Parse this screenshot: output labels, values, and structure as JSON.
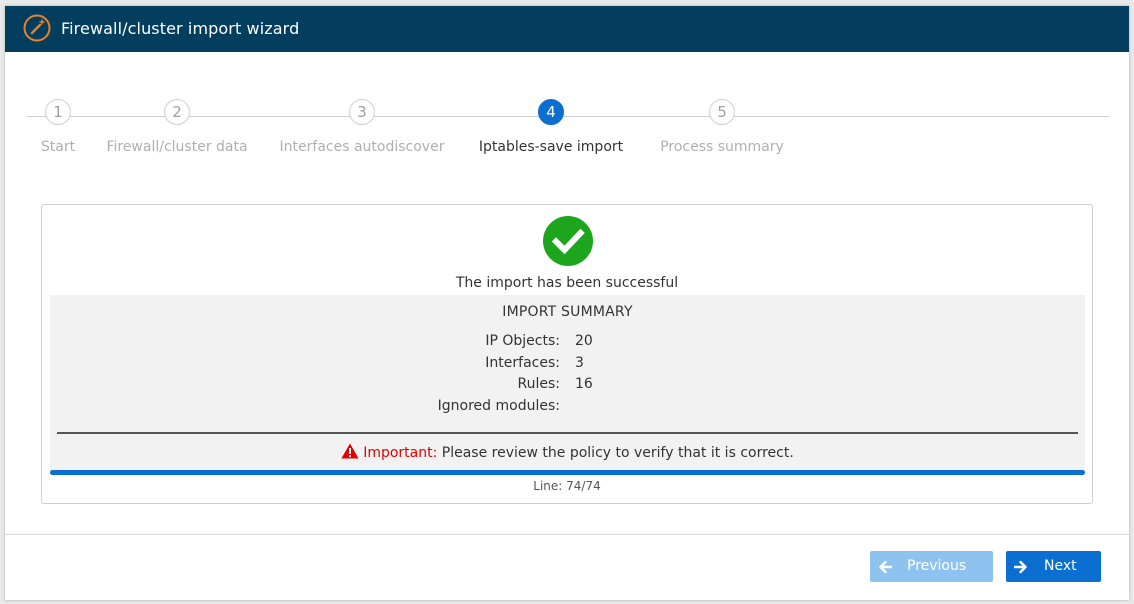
{
  "window": {
    "title": "Firewall/cluster import wizard",
    "icon": "magic-wand-icon"
  },
  "steps": [
    {
      "number": "1",
      "label": "Start",
      "state": "inactive"
    },
    {
      "number": "2",
      "label": "Firewall/cluster data",
      "state": "inactive"
    },
    {
      "number": "3",
      "label": "Interfaces autodiscover",
      "state": "inactive"
    },
    {
      "number": "4",
      "label": "Iptables-save import",
      "state": "active"
    },
    {
      "number": "5",
      "label": "Process summary",
      "state": "inactive"
    }
  ],
  "result": {
    "icon": "check-circle-icon",
    "status_text": "The import has been successful",
    "summary_title": "IMPORT SUMMARY",
    "rows": [
      {
        "label": "IP Objects:",
        "value": "20"
      },
      {
        "label": "Interfaces:",
        "value": "3"
      },
      {
        "label": "Rules:",
        "value": "16"
      },
      {
        "label": "Ignored modules:",
        "value": ""
      }
    ],
    "important_label": "Important:",
    "important_text": "Please review the policy to verify that it is correct.",
    "progress_fraction": 1.0,
    "line_text": "Line: 74/74"
  },
  "buttons": {
    "previous_label": "Previous",
    "next_label": "Next"
  },
  "colors": {
    "titlebar": "#033e5f",
    "accent": "#0a6fd1",
    "success": "#1ea51e",
    "warning": "#e40000",
    "previous_button": "#8ec3ef"
  }
}
